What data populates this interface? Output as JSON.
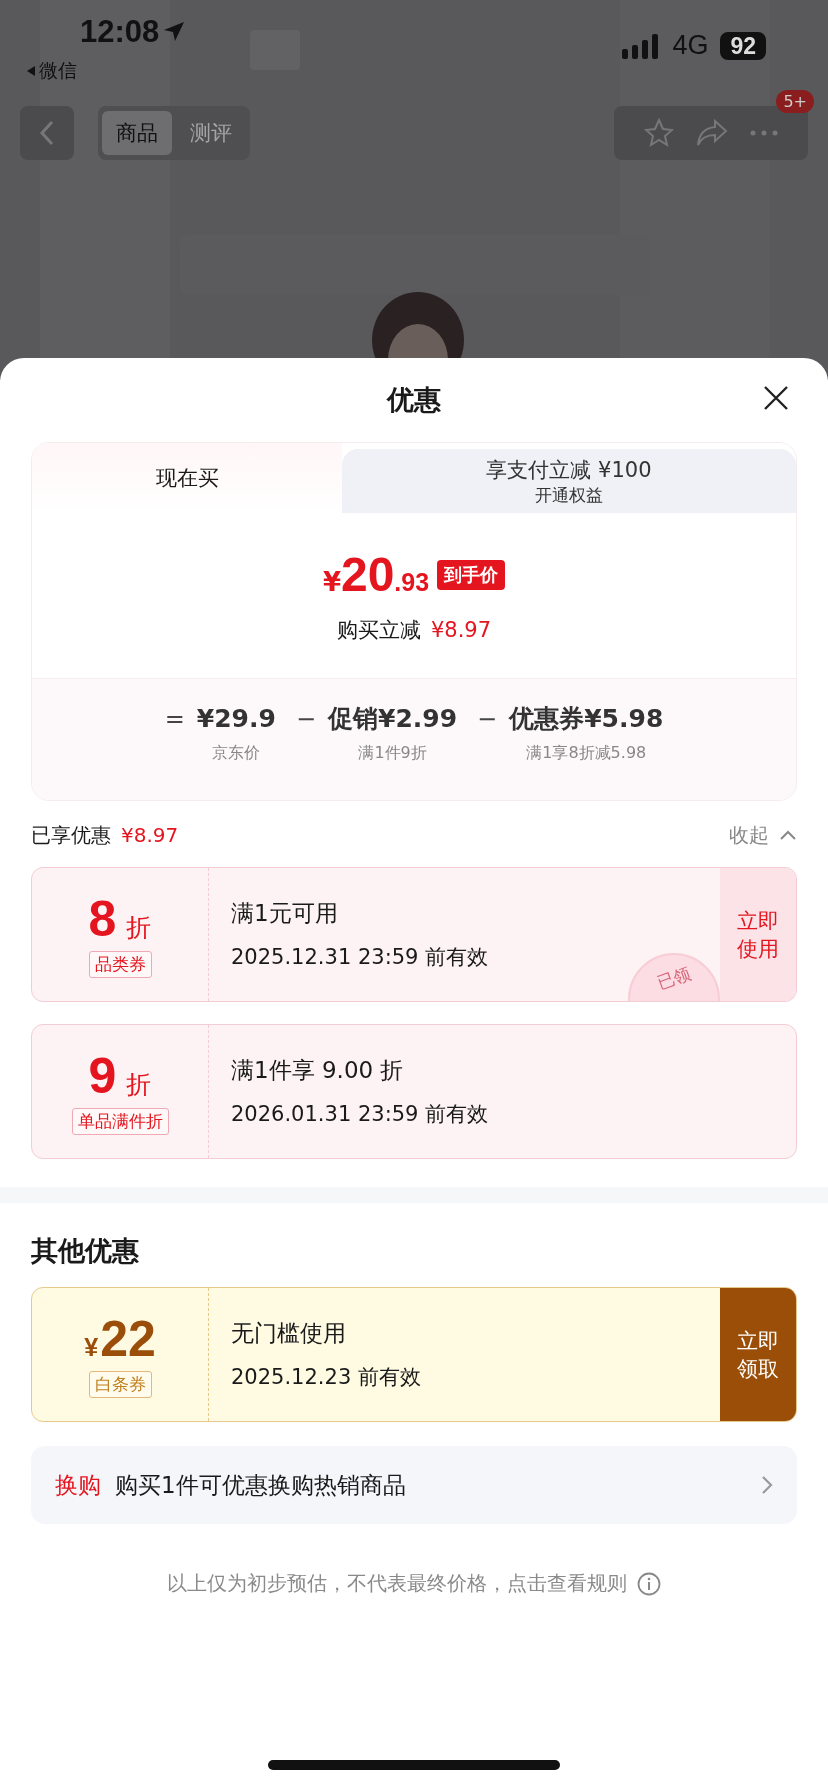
{
  "status_bar": {
    "time": "12:08",
    "back_app": "微信",
    "network": "4G",
    "battery": "92"
  },
  "nav": {
    "tabs": [
      {
        "label": "商品",
        "selected": true
      },
      {
        "label": "测评",
        "selected": false
      }
    ],
    "badge": "5+"
  },
  "sheet": {
    "title": "优惠",
    "price_tabs": [
      {
        "label": "现在买",
        "selected": true
      },
      {
        "label": "享支付立减 ¥100",
        "sublabel": "开通权益",
        "selected": false
      }
    ],
    "final_price": {
      "currency": "¥",
      "integer": "20",
      "decimal": ".93",
      "tag": "到手价"
    },
    "reduction": {
      "label": "购买立减",
      "amount": "¥8.97"
    },
    "breakdown": [
      {
        "operator": "=",
        "amount": "¥29.9",
        "note": "京东价"
      },
      {
        "operator": "−",
        "name": "促销",
        "amount": "¥2.99",
        "note": "满1件9折"
      },
      {
        "operator": "−",
        "name": "优惠券",
        "amount": "¥5.98",
        "note": "满1享8折减5.98"
      }
    ],
    "enjoyed": {
      "label": "已享优惠",
      "amount": "¥8.97",
      "toggle": "收起",
      "expanded": true
    },
    "coupons": [
      {
        "kind": "discount",
        "value": "8",
        "unit": "折",
        "tag": "品类券",
        "condition": "满1元可用",
        "validity": "2025.12.31 23:59 前有效",
        "action": "立即使用",
        "stamp": "已领"
      },
      {
        "kind": "discount",
        "value": "9",
        "unit": "折",
        "tag": "单品满件折",
        "condition": "满1件享 9.00 折",
        "validity": "2026.01.31 23:59 前有效"
      }
    ],
    "other_title": "其他优惠",
    "other_coupons": [
      {
        "kind": "cash",
        "currency": "¥",
        "value": "22",
        "tag": "白条券",
        "condition": "无门槛使用",
        "validity": "2025.12.23 前有效",
        "action": "立即领取"
      }
    ],
    "exchange": {
      "tag": "换购",
      "text": "购买1件可优惠换购热销商品"
    },
    "footnote": "以上仅为初步预估，不代表最终价格，点击查看规则"
  }
}
